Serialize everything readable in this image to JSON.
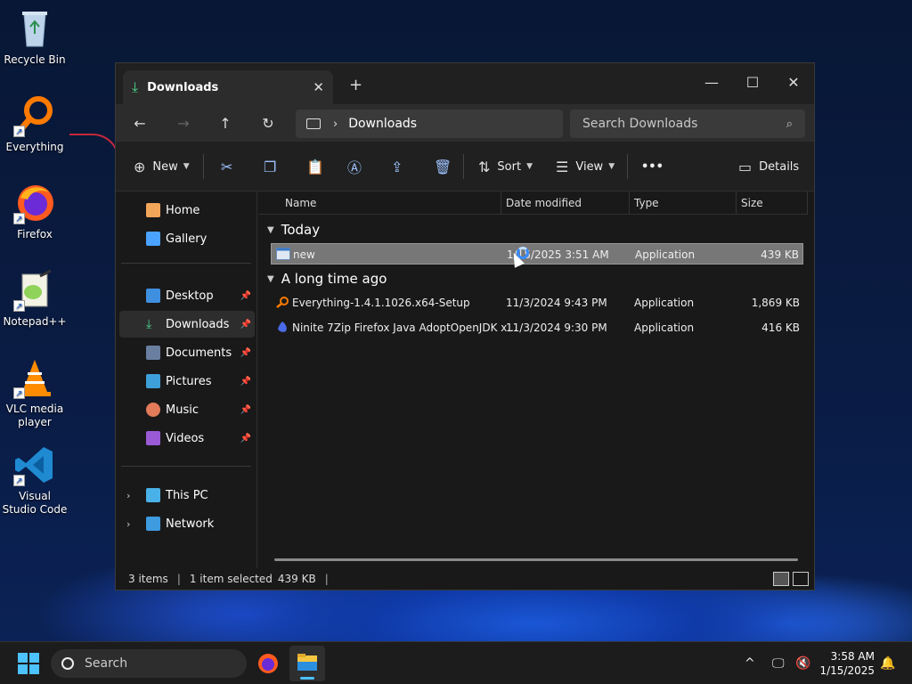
{
  "desktop": {
    "icons": [
      {
        "label": "Recycle Bin"
      },
      {
        "label": "Everything"
      },
      {
        "label": "Firefox"
      },
      {
        "label": "Notepad++"
      },
      {
        "label": "VLC media player"
      },
      {
        "label": "Visual Studio Code"
      }
    ]
  },
  "window": {
    "tab_title": "Downloads",
    "tab_close": "✕",
    "new_tab": "+",
    "controls": {
      "minimize": "—",
      "maximize": "☐",
      "close": "✕"
    },
    "nav": {
      "back": "←",
      "forward": "→",
      "up": "↑",
      "refresh": "↻"
    },
    "address": {
      "separator": "›",
      "crumb": "Downloads"
    },
    "search_placeholder": "Search Downloads",
    "toolbar": {
      "new_label": "New",
      "sort_label": "Sort",
      "view_label": "View",
      "more_label": "•••",
      "details_label": "Details"
    },
    "sidebar": {
      "home": "Home",
      "gallery": "Gallery",
      "desktop": "Desktop",
      "downloads": "Downloads",
      "documents": "Documents",
      "pictures": "Pictures",
      "music": "Music",
      "videos": "Videos",
      "this_pc": "This PC",
      "network": "Network"
    },
    "columns": {
      "name": "Name",
      "date": "Date modified",
      "type": "Type",
      "size": "Size"
    },
    "groups": {
      "today": "Today",
      "long_ago": "A long time ago"
    },
    "files": [
      {
        "name": "new",
        "date": "1/15/2025 3:51 AM",
        "type": "Application",
        "size": "439 KB"
      },
      {
        "name": "Everything-1.4.1.1026.x64-Setup",
        "date": "11/3/2024 9:43 PM",
        "type": "Application",
        "size": "1,869 KB"
      },
      {
        "name": "Ninite 7Zip Firefox Java AdoptOpenJDK x...",
        "date": "11/3/2024 9:30 PM",
        "type": "Application",
        "size": "416 KB"
      }
    ],
    "status": {
      "items": "3 items",
      "selected": "1 item selected",
      "size": "439 KB",
      "sep": "|"
    }
  },
  "taskbar": {
    "search_label": "Search",
    "time": "3:58 AM",
    "date": "1/15/2025",
    "tray_chevron": "^"
  },
  "colors": {
    "accent": "#4cc2ff",
    "window_bg": "#191919",
    "selection": "#777777"
  }
}
